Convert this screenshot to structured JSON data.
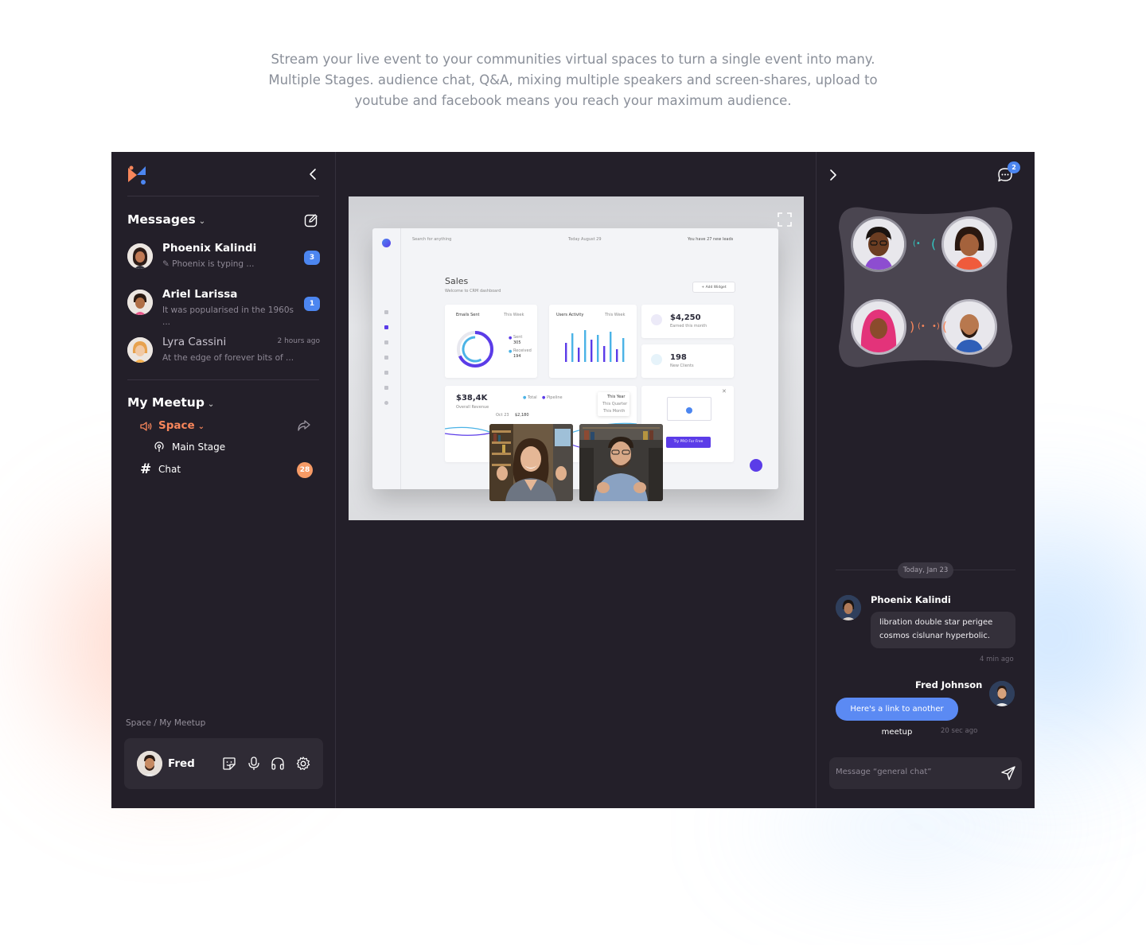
{
  "intro": {
    "line1": "Stream your live event to your communities virtual spaces to turn a single event into many.",
    "line2": "Multiple Stages. audience chat, Q&A, mixing multiple speakers and screen-shares, upload to",
    "line3": "youtube and facebook means you reach your maximum audience."
  },
  "colors": {
    "app_bg": "#231f29",
    "accent_orange": "#f7865b",
    "accent_blue": "#4c86f0",
    "bubble_out": "#5b8af3"
  },
  "sidebar": {
    "messages_title": "Messages",
    "conversations": [
      {
        "name": "Phoenix Kalindi",
        "preview": "Phoenix is typing ...",
        "badge": "3"
      },
      {
        "name": "Ariel Larissa",
        "preview": "It was popularised in the 1960s ...",
        "badge": "1"
      },
      {
        "name": "Lyra Cassini",
        "preview": "At the edge of forever bits of ...",
        "time": "2 hours ago"
      }
    ],
    "meetup_title": "My Meetup",
    "space_label": "Space",
    "main_stage_label": "Main Stage",
    "chat_label": "Chat",
    "chat_badge": "28",
    "breadcrumb": "Space / My Meetup",
    "user_name": "Fred"
  },
  "stage": {
    "dashboard": {
      "search": "Search for anything",
      "date": "Today August 29",
      "leads": "You have 27 new leads",
      "title": "Sales",
      "subtitle": "Welcome to CRM dashboard",
      "add_widget": "+ Add Widget",
      "emails_sent": "Emails Sent",
      "this_week": "This Week",
      "sent": "Sent",
      "sent_val": "305",
      "received": "Received",
      "received_val": "194",
      "users_activity": "Users Activity",
      "earned_val": "$4,250",
      "earned_lbl": "Earned this month",
      "clients_val": "198",
      "clients_lbl": "New Clients",
      "revenue_val": "$38,4K",
      "revenue_lbl": "Overall Revenue",
      "total": "Total",
      "pipeline": "Pipeline",
      "this_year": "This Year",
      "this_quarter": "This Quarter",
      "this_month": "This Month",
      "oct": "Oct 23",
      "oct_val": "$2,180",
      "try_pro": "Try PRO For Free"
    },
    "bar_heights": [
      0.6,
      0.9,
      0.45,
      1.0,
      0.7,
      0.85,
      0.5,
      0.95,
      0.4,
      0.75
    ]
  },
  "right": {
    "chat_count": "2",
    "date_pill": "Today, Jan 23",
    "messages": [
      {
        "name": "Phoenix Kalindi",
        "text_line1": "libration double star perigee",
        "text_line2": "cosmos cislunar hyperbolic.",
        "time": "4 min ago"
      },
      {
        "name": "Fred Johnson",
        "text": "Here's a link to another meetup",
        "time": "20 sec ago"
      }
    ],
    "composer_placeholder": "Message “general chat”"
  }
}
